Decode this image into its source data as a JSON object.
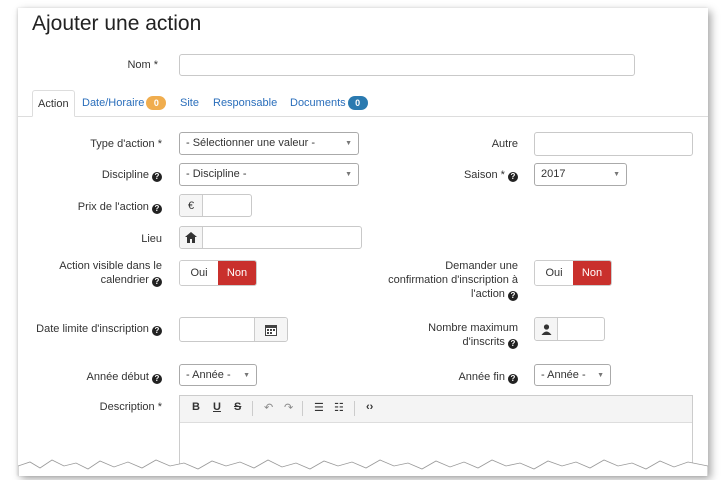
{
  "title": "Ajouter une action",
  "nom_label": "Nom *",
  "tabs": [
    {
      "label": "Action"
    },
    {
      "label": "Date/Horaire",
      "badge": "0",
      "badge_color": "#f0ad4e"
    },
    {
      "label": "Site"
    },
    {
      "label": "Responsable"
    },
    {
      "label": "Documents",
      "badge": "0",
      "badge_color": "#2a7ab0"
    }
  ],
  "form": {
    "type_action_label": "Type d'action *",
    "type_action_value": "- Sélectionner une valeur -",
    "autre_label": "Autre",
    "discipline_label": "Discipline",
    "discipline_value": "- Discipline -",
    "saison_label": "Saison *",
    "saison_value": "2017",
    "prix_label": "Prix de l'action",
    "prix_addon": "€",
    "lieu_label": "Lieu",
    "visible_label_1": "Action visible dans le",
    "visible_label_2": "calendrier",
    "confirm_label_1": "Demander une",
    "confirm_label_2": "confirmation d'inscription à",
    "confirm_label_3": "l'action",
    "toggle_oui": "Oui",
    "toggle_non": "Non",
    "date_limite_label": "Date limite d'inscription",
    "max_label_1": "Nombre maximum",
    "max_label_2": "d'inscrits",
    "annee_debut_label": "Année début",
    "annee_debut_value": "- Année -",
    "annee_fin_label": "Année fin",
    "annee_fin_value": "- Année -",
    "description_label": "Description *"
  },
  "help_icon": "?",
  "editor_toolbar": {
    "bold": "B",
    "underline": "U",
    "strike": "S",
    "undo": "↶",
    "redo": "↷",
    "bullets": "☰",
    "numbers": "☷",
    "code": "‹›"
  },
  "icons": {
    "prix_addon": "euro-icon",
    "lieu_addon": "home-icon",
    "date_addon": "calendar-icon",
    "max_addon": "user-icon"
  },
  "colors": {
    "danger": "#c9302c",
    "link": "#2a6ebb",
    "badge_orange": "#f0ad4e",
    "badge_blue": "#2a7ab0"
  }
}
